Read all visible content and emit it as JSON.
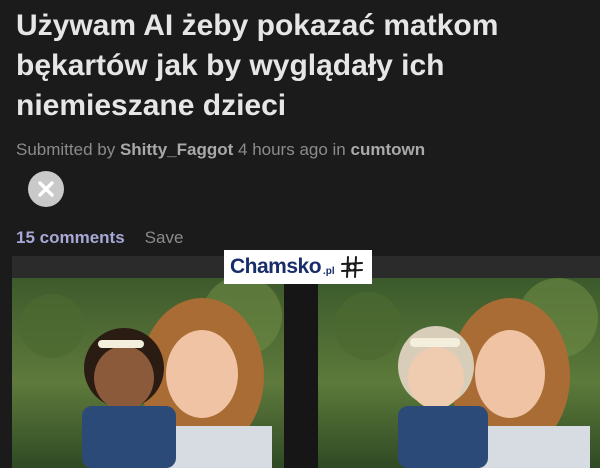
{
  "post": {
    "title": "Używam AI żeby pokazać matkom bękartów jak by wyglądały ich niemieszane dzieci",
    "submitted_prefix": "Submitted by ",
    "author": "Shitty_Faggot",
    "time": " 4 hours ago in ",
    "subreddit": "cumtown"
  },
  "actions": {
    "comments": "15 comments",
    "save": "Save"
  },
  "watermark": {
    "brand": "Chamsko",
    "tld": ".pl"
  },
  "icons": {
    "close": "close-icon",
    "watermark": "crosshair-icon"
  },
  "colors": {
    "background": "#1b1b1c",
    "title": "#e6e6e6",
    "meta": "#8b8b8b",
    "comments_link": "#a8a8d6",
    "brand": "#1a2d6b"
  }
}
